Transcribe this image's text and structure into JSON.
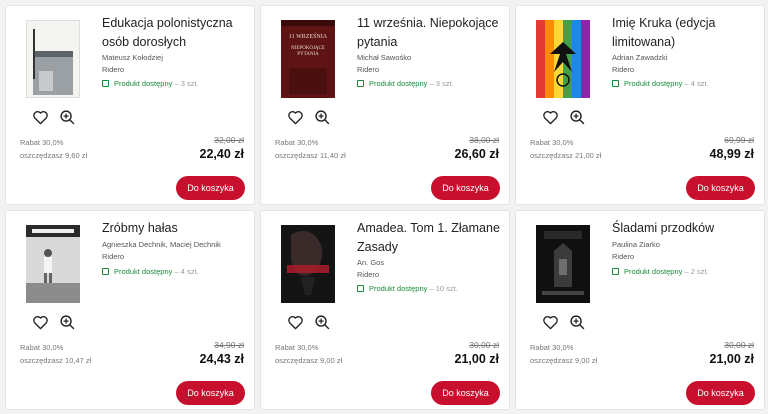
{
  "products": [
    {
      "title": "Edukacja polonistyczna osób dorosłych",
      "author": "Mateusz Kołodziej",
      "publisher": "Ridero",
      "availability": "Produkt dostępny",
      "quantity": "– 3 szt.",
      "discount": "Rabat 30,0%",
      "saving": "oszczędzasz 9,60 zł",
      "old_price": "32,00 zł",
      "price": "22,40 zł",
      "cart_label": "Do koszyka"
    },
    {
      "title": "11 września. Niepokojące pytania",
      "author": "Michał Sawośko",
      "publisher": "Ridero",
      "availability": "Produkt dostępny",
      "quantity": "– 3 szt.",
      "discount": "Rabat 30,0%",
      "saving": "oszczędzasz 11,40 zł",
      "old_price": "38,00 zł",
      "price": "26,60 zł",
      "cart_label": "Do koszyka",
      "cover_text_top": "11 WRZEŚNIA",
      "cover_text_bottom": "NIEPOKOJĄCE PYTANIA"
    },
    {
      "title": "Imię Kruka (edycja limitowana)",
      "author": "Adrian Zawadzki",
      "publisher": "Ridero",
      "availability": "Produkt dostępny",
      "quantity": "– 4 szt.",
      "discount": "Rabat 30,0%",
      "saving": "oszczędzasz 21,00 zł",
      "old_price": "69,99 zł",
      "price": "48,99 zł",
      "cart_label": "Do koszyka"
    },
    {
      "title": "Zróbmy hałas",
      "author": "Agnieszka Dechnik, Maciej Dechnik",
      "publisher": "Ridero",
      "availability": "Produkt dostępny",
      "quantity": "– 4 szt.",
      "discount": "Rabat 30,0%",
      "saving": "oszczędzasz 10,47 zł",
      "old_price": "34,90 zł",
      "price": "24,43 zł",
      "cart_label": "Do koszyka"
    },
    {
      "title": "Amadea. Tom 1. Złamane Zasady",
      "author": "An. Gos",
      "publisher": "Ridero",
      "availability": "Produkt dostępny",
      "quantity": "– 10 szt.",
      "discount": "Rabat 30,0%",
      "saving": "oszczędzasz 9,00 zł",
      "old_price": "30,00 zł",
      "price": "21,00 zł",
      "cart_label": "Do koszyka"
    },
    {
      "title": "Śladami przodków",
      "author": "Paulina Ziarko",
      "publisher": "Ridero",
      "availability": "Produkt dostępny",
      "quantity": "– 2 szt.",
      "discount": "Rabat 30,0%",
      "saving": "oszczędzasz 9,00 zł",
      "old_price": "30,00 zł",
      "price": "21,00 zł",
      "cart_label": "Do koszyka"
    }
  ],
  "colors": {
    "accent": "#c8102e",
    "available": "#1a8a3a",
    "muted": "#777777"
  },
  "icons": {
    "wishlist": "heart-icon",
    "preview": "zoom-icon",
    "availability": "check-icon"
  }
}
